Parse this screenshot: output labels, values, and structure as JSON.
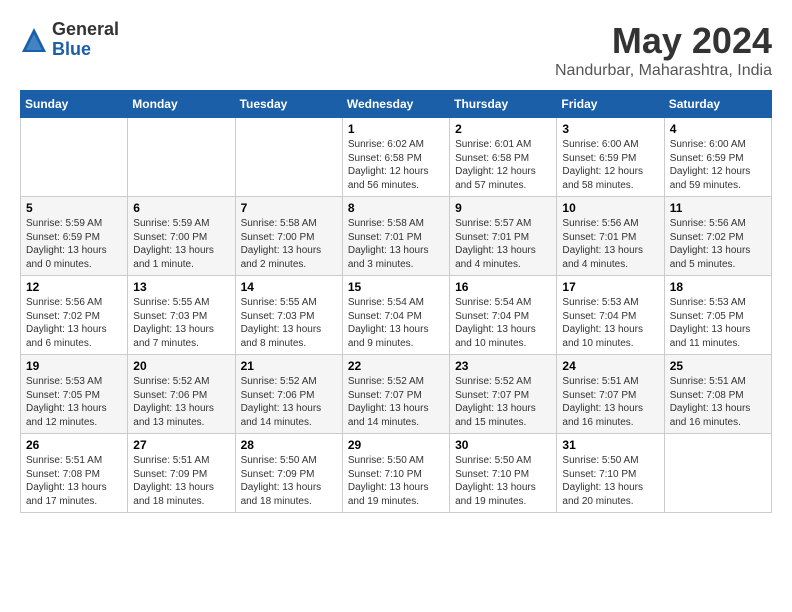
{
  "header": {
    "logo_general": "General",
    "logo_blue": "Blue",
    "month": "May 2024",
    "location": "Nandurbar, Maharashtra, India"
  },
  "days_of_week": [
    "Sunday",
    "Monday",
    "Tuesday",
    "Wednesday",
    "Thursday",
    "Friday",
    "Saturday"
  ],
  "weeks": [
    [
      {
        "day": "",
        "content": ""
      },
      {
        "day": "",
        "content": ""
      },
      {
        "day": "",
        "content": ""
      },
      {
        "day": "1",
        "content": "Sunrise: 6:02 AM\nSunset: 6:58 PM\nDaylight: 12 hours and 56 minutes."
      },
      {
        "day": "2",
        "content": "Sunrise: 6:01 AM\nSunset: 6:58 PM\nDaylight: 12 hours and 57 minutes."
      },
      {
        "day": "3",
        "content": "Sunrise: 6:00 AM\nSunset: 6:59 PM\nDaylight: 12 hours and 58 minutes."
      },
      {
        "day": "4",
        "content": "Sunrise: 6:00 AM\nSunset: 6:59 PM\nDaylight: 12 hours and 59 minutes."
      }
    ],
    [
      {
        "day": "5",
        "content": "Sunrise: 5:59 AM\nSunset: 6:59 PM\nDaylight: 13 hours and 0 minutes."
      },
      {
        "day": "6",
        "content": "Sunrise: 5:59 AM\nSunset: 7:00 PM\nDaylight: 13 hours and 1 minute."
      },
      {
        "day": "7",
        "content": "Sunrise: 5:58 AM\nSunset: 7:00 PM\nDaylight: 13 hours and 2 minutes."
      },
      {
        "day": "8",
        "content": "Sunrise: 5:58 AM\nSunset: 7:01 PM\nDaylight: 13 hours and 3 minutes."
      },
      {
        "day": "9",
        "content": "Sunrise: 5:57 AM\nSunset: 7:01 PM\nDaylight: 13 hours and 4 minutes."
      },
      {
        "day": "10",
        "content": "Sunrise: 5:56 AM\nSunset: 7:01 PM\nDaylight: 13 hours and 4 minutes."
      },
      {
        "day": "11",
        "content": "Sunrise: 5:56 AM\nSunset: 7:02 PM\nDaylight: 13 hours and 5 minutes."
      }
    ],
    [
      {
        "day": "12",
        "content": "Sunrise: 5:56 AM\nSunset: 7:02 PM\nDaylight: 13 hours and 6 minutes."
      },
      {
        "day": "13",
        "content": "Sunrise: 5:55 AM\nSunset: 7:03 PM\nDaylight: 13 hours and 7 minutes."
      },
      {
        "day": "14",
        "content": "Sunrise: 5:55 AM\nSunset: 7:03 PM\nDaylight: 13 hours and 8 minutes."
      },
      {
        "day": "15",
        "content": "Sunrise: 5:54 AM\nSunset: 7:04 PM\nDaylight: 13 hours and 9 minutes."
      },
      {
        "day": "16",
        "content": "Sunrise: 5:54 AM\nSunset: 7:04 PM\nDaylight: 13 hours and 10 minutes."
      },
      {
        "day": "17",
        "content": "Sunrise: 5:53 AM\nSunset: 7:04 PM\nDaylight: 13 hours and 10 minutes."
      },
      {
        "day": "18",
        "content": "Sunrise: 5:53 AM\nSunset: 7:05 PM\nDaylight: 13 hours and 11 minutes."
      }
    ],
    [
      {
        "day": "19",
        "content": "Sunrise: 5:53 AM\nSunset: 7:05 PM\nDaylight: 13 hours and 12 minutes."
      },
      {
        "day": "20",
        "content": "Sunrise: 5:52 AM\nSunset: 7:06 PM\nDaylight: 13 hours and 13 minutes."
      },
      {
        "day": "21",
        "content": "Sunrise: 5:52 AM\nSunset: 7:06 PM\nDaylight: 13 hours and 14 minutes."
      },
      {
        "day": "22",
        "content": "Sunrise: 5:52 AM\nSunset: 7:07 PM\nDaylight: 13 hours and 14 minutes."
      },
      {
        "day": "23",
        "content": "Sunrise: 5:52 AM\nSunset: 7:07 PM\nDaylight: 13 hours and 15 minutes."
      },
      {
        "day": "24",
        "content": "Sunrise: 5:51 AM\nSunset: 7:07 PM\nDaylight: 13 hours and 16 minutes."
      },
      {
        "day": "25",
        "content": "Sunrise: 5:51 AM\nSunset: 7:08 PM\nDaylight: 13 hours and 16 minutes."
      }
    ],
    [
      {
        "day": "26",
        "content": "Sunrise: 5:51 AM\nSunset: 7:08 PM\nDaylight: 13 hours and 17 minutes."
      },
      {
        "day": "27",
        "content": "Sunrise: 5:51 AM\nSunset: 7:09 PM\nDaylight: 13 hours and 18 minutes."
      },
      {
        "day": "28",
        "content": "Sunrise: 5:50 AM\nSunset: 7:09 PM\nDaylight: 13 hours and 18 minutes."
      },
      {
        "day": "29",
        "content": "Sunrise: 5:50 AM\nSunset: 7:10 PM\nDaylight: 13 hours and 19 minutes."
      },
      {
        "day": "30",
        "content": "Sunrise: 5:50 AM\nSunset: 7:10 PM\nDaylight: 13 hours and 19 minutes."
      },
      {
        "day": "31",
        "content": "Sunrise: 5:50 AM\nSunset: 7:10 PM\nDaylight: 13 hours and 20 minutes."
      },
      {
        "day": "",
        "content": ""
      }
    ]
  ]
}
